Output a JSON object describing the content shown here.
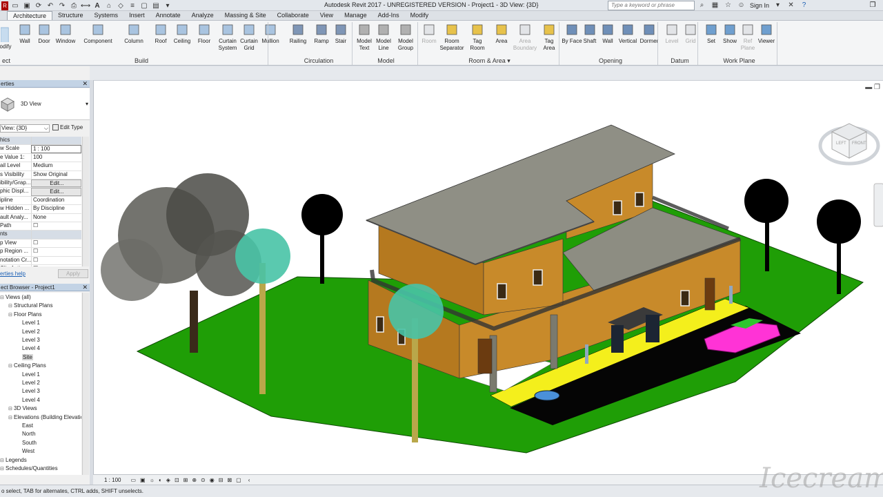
{
  "window": {
    "title": "Autodesk Revit 2017 -  UNREGISTERED VERSION -    Project1 - 3D View: {3D}",
    "search_placeholder": "Type a keyword or phrase",
    "sign_in": "Sign In"
  },
  "tabs": [
    "Architecture",
    "Structure",
    "Systems",
    "Insert",
    "Annotate",
    "Analyze",
    "Massing & Site",
    "Collaborate",
    "View",
    "Manage",
    "Add-Ins",
    "Modify"
  ],
  "active_tab": "Architecture",
  "ribbon": {
    "modify": "odify",
    "select_label": "ect ▾",
    "build": {
      "label": "Build",
      "buttons": [
        "Wall",
        "Door",
        "Window",
        "Component",
        "Column",
        "Roof",
        "Ceiling",
        "Floor",
        "Curtain System",
        "Curtain Grid",
        "Mullion"
      ]
    },
    "circulation": {
      "label": "Circulation",
      "buttons": [
        "Railing",
        "Ramp",
        "Stair"
      ]
    },
    "model": {
      "label": "Model",
      "buttons": [
        "Model Text",
        "Model Line",
        "Model Group"
      ]
    },
    "room_area": {
      "label": "Room & Area ▾",
      "buttons": [
        "Room",
        "Room Separator",
        "Tag Room",
        "Area",
        "Area Boundary",
        "Tag Area"
      ]
    },
    "opening": {
      "label": "Opening",
      "buttons": [
        "By Face",
        "Shaft",
        "Wall",
        "Vertical",
        "Dormer"
      ]
    },
    "datum": {
      "label": "Datum",
      "buttons": [
        "Level",
        "Grid"
      ]
    },
    "work_plane": {
      "label": "Work Plane",
      "buttons": [
        "Set",
        "Show",
        "Ref Plane",
        "Viewer"
      ]
    }
  },
  "properties": {
    "title": "erties",
    "type_name": "3D View",
    "selector": "View: {3D}",
    "edit_type": "Edit Type",
    "rows": [
      {
        "k": "hics",
        "v": "",
        "group": true
      },
      {
        "k": "w Scale",
        "v": "1 : 100"
      },
      {
        "k": "e Value  1:",
        "v": "100"
      },
      {
        "k": "ail Level",
        "v": "Medium"
      },
      {
        "k": "s Visibility",
        "v": "Show Original"
      },
      {
        "k": "ibility/Grap...",
        "v": "Edit..."
      },
      {
        "k": "phic Displ...",
        "v": "Edit..."
      },
      {
        "k": "ipline",
        "v": "Coordination"
      },
      {
        "k": "w Hidden ...",
        "v": "By Discipline"
      },
      {
        "k": "ault Analy...",
        "v": "None"
      },
      {
        "k": "Path",
        "v": "☐"
      },
      {
        "k": "nts",
        "v": "",
        "group": true
      },
      {
        "k": "p View",
        "v": "☐"
      },
      {
        "k": "p Region ...",
        "v": "☐"
      },
      {
        "k": "notation Cr...",
        "v": "☐"
      },
      {
        "k": "Clip Active",
        "v": "☐"
      }
    ],
    "help": "erties help",
    "apply": "Apply"
  },
  "browser": {
    "title": "ect Browser - Project1",
    "items": [
      {
        "t": "Views (all)",
        "i": 0
      },
      {
        "t": "Structural Plans",
        "i": 1
      },
      {
        "t": "Floor Plans",
        "i": 1
      },
      {
        "t": "Level 1",
        "i": 2
      },
      {
        "t": "Level 2",
        "i": 2
      },
      {
        "t": "Level 3",
        "i": 2
      },
      {
        "t": "Level 4",
        "i": 2
      },
      {
        "t": "Site",
        "i": 2,
        "sel": true
      },
      {
        "t": "Ceiling Plans",
        "i": 1
      },
      {
        "t": "Level 1",
        "i": 2
      },
      {
        "t": "Level 2",
        "i": 2
      },
      {
        "t": "Level 3",
        "i": 2
      },
      {
        "t": "Level 4",
        "i": 2
      },
      {
        "t": "3D Views",
        "i": 1
      },
      {
        "t": "Elevations (Building Elevation",
        "i": 1
      },
      {
        "t": "East",
        "i": 2
      },
      {
        "t": "North",
        "i": 2
      },
      {
        "t": "South",
        "i": 2
      },
      {
        "t": "West",
        "i": 2
      },
      {
        "t": "Legends",
        "i": 0
      },
      {
        "t": "Schedules/Quantities",
        "i": 0
      }
    ]
  },
  "viewbar": {
    "scale": "1 : 100"
  },
  "status": {
    "text": "o select, TAB for alternates, CTRL adds, SHIFT unselects."
  },
  "viewcube": {
    "left": "LEFT",
    "front": "FRONT"
  },
  "watermark": "Icecream",
  "colors": {
    "grass": "#1f9e06",
    "wall": "#c88a2a",
    "roof": "#8d8d82",
    "road": "#050505",
    "sidewalk": "#f4ef1c",
    "car": "#ff33d6"
  }
}
